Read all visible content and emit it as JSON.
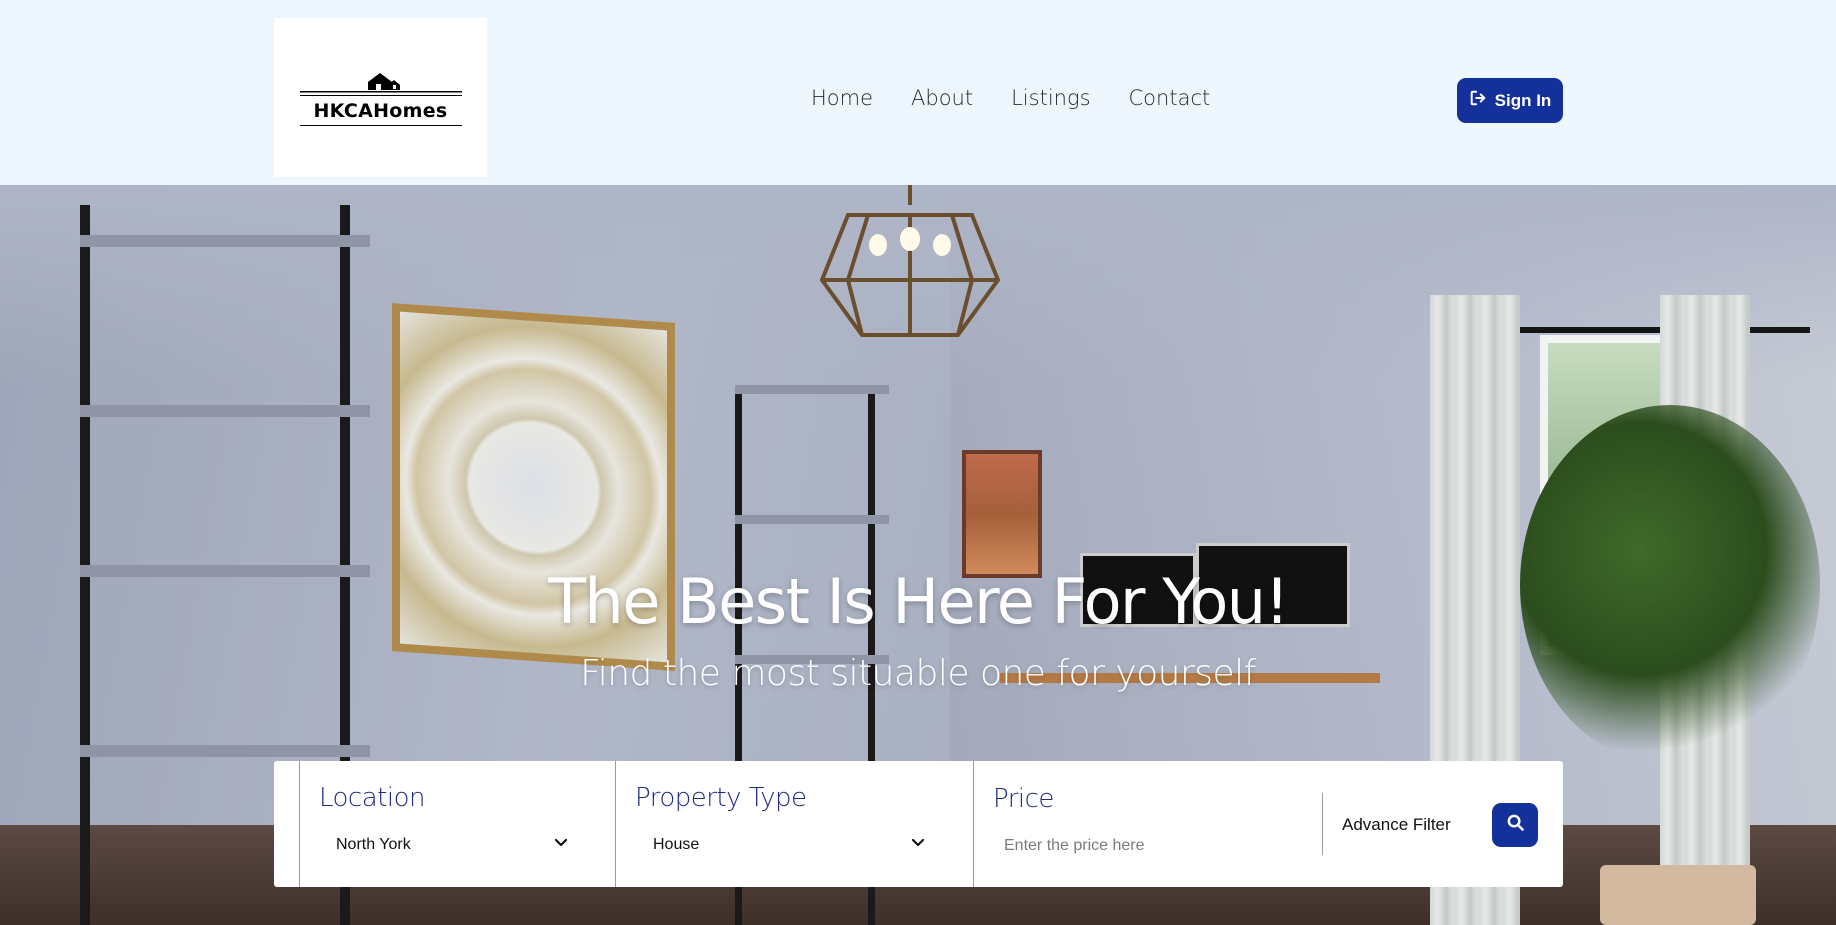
{
  "brand": {
    "name": "HKCAHomes"
  },
  "nav": {
    "items": [
      {
        "label": "Home"
      },
      {
        "label": "About"
      },
      {
        "label": "Listings"
      },
      {
        "label": "Contact"
      }
    ]
  },
  "header": {
    "signin_label": "Sign In"
  },
  "hero": {
    "title": "The Best Is Here For You!",
    "subtitle": "Find the most situable one for yourself"
  },
  "search": {
    "location": {
      "label": "Location",
      "value": "North York"
    },
    "property_type": {
      "label": "Property Type",
      "value": "House"
    },
    "price": {
      "label": "Price",
      "placeholder": "Enter the price here",
      "value": ""
    },
    "advance_filter_label": "Advance Filter"
  },
  "colors": {
    "accent": "#14309a",
    "label": "#1e2a86",
    "header_bg": "#eef6fe"
  },
  "icons": {
    "signin": "sign-in-icon",
    "dropdown": "chevron-down-icon",
    "search": "search-icon",
    "logo": "house-icon"
  }
}
